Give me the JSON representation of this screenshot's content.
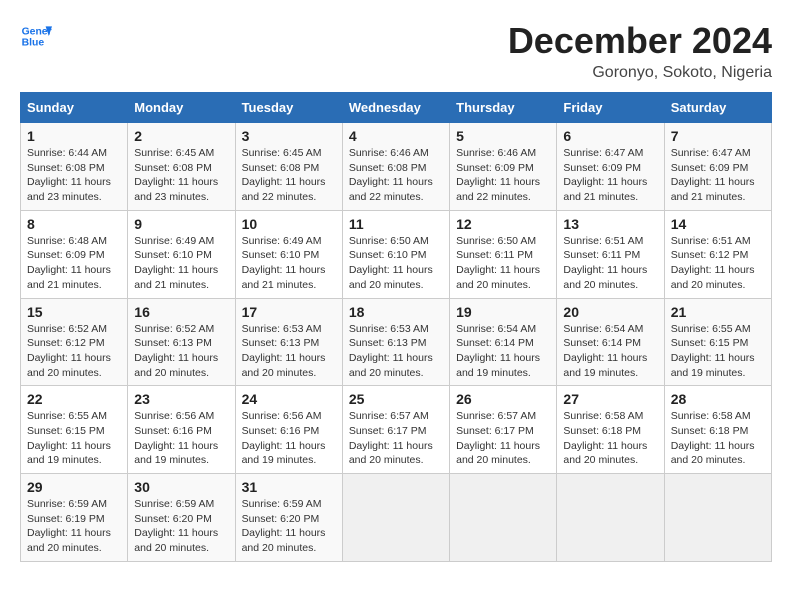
{
  "header": {
    "logo_line1": "General",
    "logo_line2": "Blue",
    "month": "December 2024",
    "location": "Goronyo, Sokoto, Nigeria"
  },
  "days_of_week": [
    "Sunday",
    "Monday",
    "Tuesday",
    "Wednesday",
    "Thursday",
    "Friday",
    "Saturday"
  ],
  "weeks": [
    [
      {
        "day": 1,
        "info": "Sunrise: 6:44 AM\nSunset: 6:08 PM\nDaylight: 11 hours\nand 23 minutes."
      },
      {
        "day": 2,
        "info": "Sunrise: 6:45 AM\nSunset: 6:08 PM\nDaylight: 11 hours\nand 23 minutes."
      },
      {
        "day": 3,
        "info": "Sunrise: 6:45 AM\nSunset: 6:08 PM\nDaylight: 11 hours\nand 22 minutes."
      },
      {
        "day": 4,
        "info": "Sunrise: 6:46 AM\nSunset: 6:08 PM\nDaylight: 11 hours\nand 22 minutes."
      },
      {
        "day": 5,
        "info": "Sunrise: 6:46 AM\nSunset: 6:09 PM\nDaylight: 11 hours\nand 22 minutes."
      },
      {
        "day": 6,
        "info": "Sunrise: 6:47 AM\nSunset: 6:09 PM\nDaylight: 11 hours\nand 21 minutes."
      },
      {
        "day": 7,
        "info": "Sunrise: 6:47 AM\nSunset: 6:09 PM\nDaylight: 11 hours\nand 21 minutes."
      }
    ],
    [
      {
        "day": 8,
        "info": "Sunrise: 6:48 AM\nSunset: 6:09 PM\nDaylight: 11 hours\nand 21 minutes."
      },
      {
        "day": 9,
        "info": "Sunrise: 6:49 AM\nSunset: 6:10 PM\nDaylight: 11 hours\nand 21 minutes."
      },
      {
        "day": 10,
        "info": "Sunrise: 6:49 AM\nSunset: 6:10 PM\nDaylight: 11 hours\nand 21 minutes."
      },
      {
        "day": 11,
        "info": "Sunrise: 6:50 AM\nSunset: 6:10 PM\nDaylight: 11 hours\nand 20 minutes."
      },
      {
        "day": 12,
        "info": "Sunrise: 6:50 AM\nSunset: 6:11 PM\nDaylight: 11 hours\nand 20 minutes."
      },
      {
        "day": 13,
        "info": "Sunrise: 6:51 AM\nSunset: 6:11 PM\nDaylight: 11 hours\nand 20 minutes."
      },
      {
        "day": 14,
        "info": "Sunrise: 6:51 AM\nSunset: 6:12 PM\nDaylight: 11 hours\nand 20 minutes."
      }
    ],
    [
      {
        "day": 15,
        "info": "Sunrise: 6:52 AM\nSunset: 6:12 PM\nDaylight: 11 hours\nand 20 minutes."
      },
      {
        "day": 16,
        "info": "Sunrise: 6:52 AM\nSunset: 6:13 PM\nDaylight: 11 hours\nand 20 minutes."
      },
      {
        "day": 17,
        "info": "Sunrise: 6:53 AM\nSunset: 6:13 PM\nDaylight: 11 hours\nand 20 minutes."
      },
      {
        "day": 18,
        "info": "Sunrise: 6:53 AM\nSunset: 6:13 PM\nDaylight: 11 hours\nand 20 minutes."
      },
      {
        "day": 19,
        "info": "Sunrise: 6:54 AM\nSunset: 6:14 PM\nDaylight: 11 hours\nand 19 minutes."
      },
      {
        "day": 20,
        "info": "Sunrise: 6:54 AM\nSunset: 6:14 PM\nDaylight: 11 hours\nand 19 minutes."
      },
      {
        "day": 21,
        "info": "Sunrise: 6:55 AM\nSunset: 6:15 PM\nDaylight: 11 hours\nand 19 minutes."
      }
    ],
    [
      {
        "day": 22,
        "info": "Sunrise: 6:55 AM\nSunset: 6:15 PM\nDaylight: 11 hours\nand 19 minutes."
      },
      {
        "day": 23,
        "info": "Sunrise: 6:56 AM\nSunset: 6:16 PM\nDaylight: 11 hours\nand 19 minutes."
      },
      {
        "day": 24,
        "info": "Sunrise: 6:56 AM\nSunset: 6:16 PM\nDaylight: 11 hours\nand 19 minutes."
      },
      {
        "day": 25,
        "info": "Sunrise: 6:57 AM\nSunset: 6:17 PM\nDaylight: 11 hours\nand 20 minutes."
      },
      {
        "day": 26,
        "info": "Sunrise: 6:57 AM\nSunset: 6:17 PM\nDaylight: 11 hours\nand 20 minutes."
      },
      {
        "day": 27,
        "info": "Sunrise: 6:58 AM\nSunset: 6:18 PM\nDaylight: 11 hours\nand 20 minutes."
      },
      {
        "day": 28,
        "info": "Sunrise: 6:58 AM\nSunset: 6:18 PM\nDaylight: 11 hours\nand 20 minutes."
      }
    ],
    [
      {
        "day": 29,
        "info": "Sunrise: 6:59 AM\nSunset: 6:19 PM\nDaylight: 11 hours\nand 20 minutes."
      },
      {
        "day": 30,
        "info": "Sunrise: 6:59 AM\nSunset: 6:20 PM\nDaylight: 11 hours\nand 20 minutes."
      },
      {
        "day": 31,
        "info": "Sunrise: 6:59 AM\nSunset: 6:20 PM\nDaylight: 11 hours\nand 20 minutes."
      },
      null,
      null,
      null,
      null
    ]
  ]
}
